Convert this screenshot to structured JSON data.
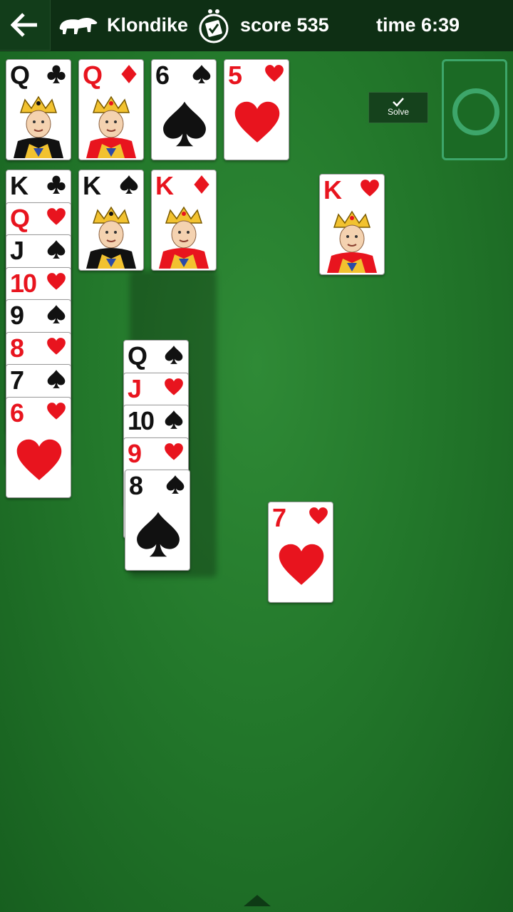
{
  "header": {
    "back_icon": "arrow-left-icon",
    "game_icon": "polar-bear-icon",
    "game_name": "Klondike",
    "xbox_icon": "xbox-achievements-icon",
    "score_text": "score 535",
    "time_text": "time 6:39"
  },
  "solve_button": {
    "label": "Solve",
    "icon": "checkmark-icon"
  },
  "stock": {
    "icon": "recycle-ring-icon",
    "state": "empty"
  },
  "colors": {
    "felt": "#23782b",
    "topbar": "#0e2f14",
    "red_suit": "#e8141e",
    "black_suit": "#111111",
    "stock_ring": "#3da66a"
  },
  "foundations": [
    {
      "rank": "Q",
      "suit": "clubs",
      "color": "black"
    },
    {
      "rank": "Q",
      "suit": "diamonds",
      "color": "red"
    },
    {
      "rank": "6",
      "suit": "spades",
      "color": "black"
    },
    {
      "rank": "5",
      "suit": "hearts",
      "color": "red"
    }
  ],
  "tableau": [
    {
      "column": 1,
      "cards": [
        {
          "rank": "K",
          "suit": "clubs",
          "color": "black"
        },
        {
          "rank": "Q",
          "suit": "hearts",
          "color": "red"
        },
        {
          "rank": "J",
          "suit": "spades",
          "color": "black"
        },
        {
          "rank": "10",
          "suit": "hearts",
          "color": "red"
        },
        {
          "rank": "9",
          "suit": "spades",
          "color": "black"
        },
        {
          "rank": "8",
          "suit": "hearts",
          "color": "red"
        },
        {
          "rank": "7",
          "suit": "spades",
          "color": "black"
        },
        {
          "rank": "6",
          "suit": "hearts",
          "color": "red"
        }
      ]
    },
    {
      "column": 2,
      "cards": [
        {
          "rank": "K",
          "suit": "spades",
          "color": "black"
        }
      ]
    },
    {
      "column": 3,
      "cards": [
        {
          "rank": "K",
          "suit": "diamonds",
          "color": "red"
        }
      ]
    },
    {
      "column": 5,
      "cards": [
        {
          "rank": "K",
          "suit": "hearts",
          "color": "red"
        }
      ]
    }
  ],
  "dragged_stack": [
    {
      "rank": "Q",
      "suit": "spades",
      "color": "black"
    },
    {
      "rank": "J",
      "suit": "hearts",
      "color": "red"
    },
    {
      "rank": "10",
      "suit": "spades",
      "color": "black"
    },
    {
      "rank": "9",
      "suit": "hearts",
      "color": "red"
    },
    {
      "rank": "8",
      "suit": "spades",
      "color": "black"
    }
  ],
  "floating_card": {
    "rank": "7",
    "suit": "hearts",
    "color": "red"
  },
  "bottom_bar": {
    "icon": "expand-up-icon"
  }
}
